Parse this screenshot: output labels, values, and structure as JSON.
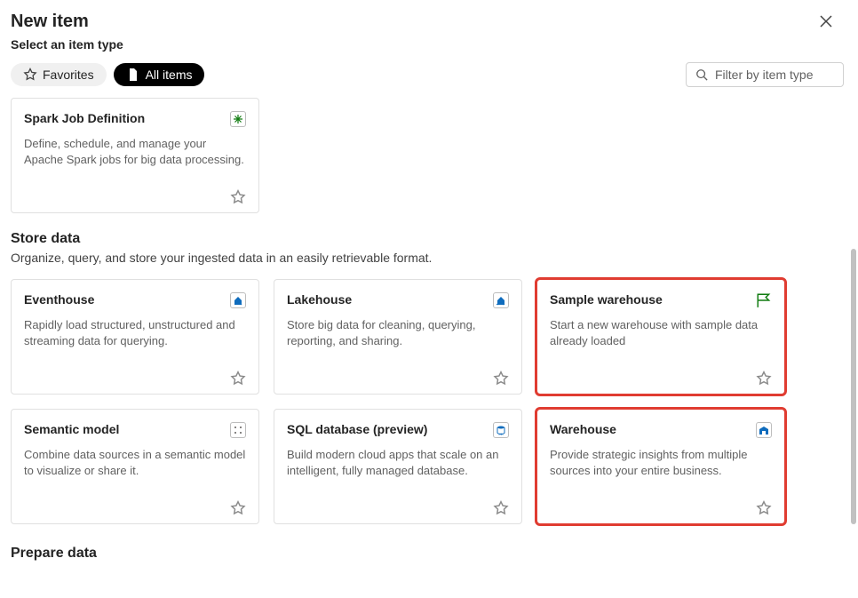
{
  "header": {
    "title": "New item",
    "subtitle": "Select an item type"
  },
  "toolbar": {
    "favorites_label": "Favorites",
    "all_items_label": "All items",
    "search_placeholder": "Filter by item type"
  },
  "top_card": {
    "title": "Spark Job Definition",
    "desc": "Define, schedule, and manage your Apache Spark jobs for big data processing."
  },
  "sections": {
    "store": {
      "title": "Store data",
      "desc": "Organize, query, and store your ingested data in an easily retrievable format.",
      "cards": [
        {
          "title": "Eventhouse",
          "desc": "Rapidly load structured, unstructured and streaming data for querying."
        },
        {
          "title": "Lakehouse",
          "desc": "Store big data for cleaning, querying, reporting, and sharing."
        },
        {
          "title": "Sample warehouse",
          "desc": "Start a new warehouse with sample data already loaded"
        },
        {
          "title": "Semantic model",
          "desc": "Combine data sources in a semantic model to visualize or share it."
        },
        {
          "title": "SQL database (preview)",
          "desc": "Build modern cloud apps that scale on an intelligent, fully managed database."
        },
        {
          "title": "Warehouse",
          "desc": "Provide strategic insights from multiple sources into your entire business."
        }
      ]
    },
    "prepare": {
      "title": "Prepare data"
    }
  }
}
